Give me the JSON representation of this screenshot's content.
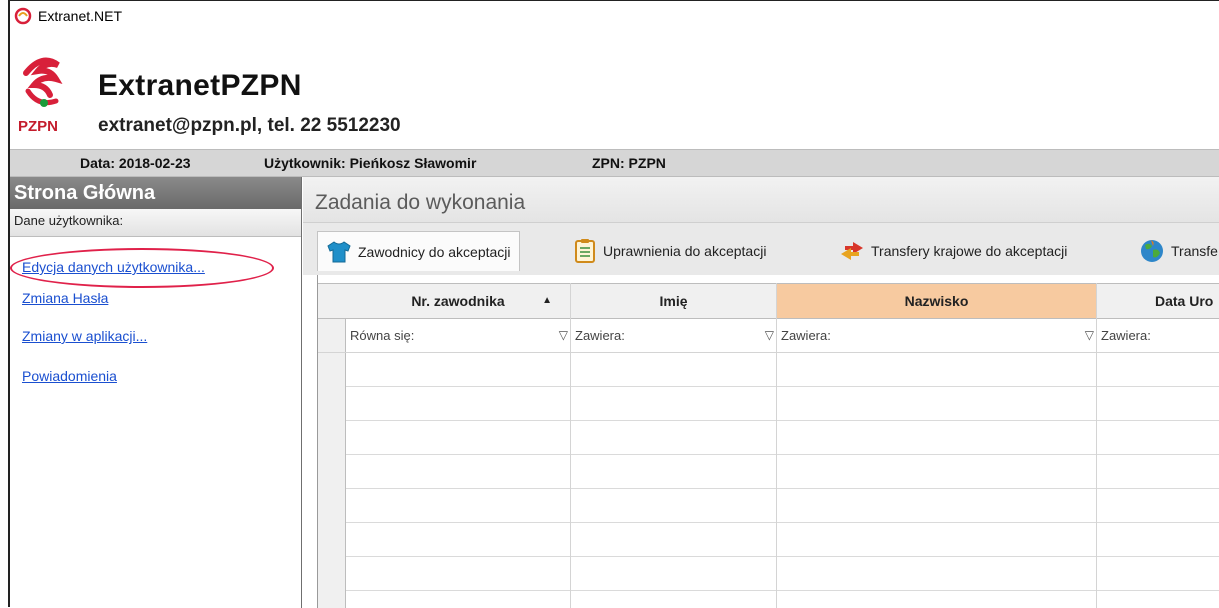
{
  "window": {
    "title": "Extranet.NET"
  },
  "header": {
    "app_title": "ExtranetPZPN",
    "contact": "extranet@pzpn.pl, tel. 22 5512230",
    "logo_text": "PZPN"
  },
  "infobar": {
    "date": "Data: 2018-02-23",
    "user": "Użytkownik: Pieńkosz Sławomir",
    "zpn": "ZPN: PZPN"
  },
  "sidebar": {
    "title": "Strona Główna",
    "section": "Dane użytkownika:",
    "links": [
      "Edycja danych użytkownika...",
      "Zmiana Hasła",
      "Zmiany w aplikacji...",
      "Powiadomienia"
    ]
  },
  "main": {
    "title": "Zadania do wykonania",
    "tabs": [
      "Zawodnicy do akceptacji",
      "Uprawnienia do akceptacji",
      "Transfery krajowe do akceptacji",
      "Transfe"
    ],
    "active_tab": 0
  },
  "grid": {
    "columns": [
      "Nr. zawodnika",
      "Imię",
      "Nazwisko",
      "Data Uro"
    ],
    "sorted_column_indicator": "▲",
    "selected_column": 2,
    "filters": [
      "Równa się:",
      "Zawiera:",
      "Zawiera:",
      "Zawiera:"
    ],
    "empty_rows": 7
  },
  "colors": {
    "link": "#1a4fd0",
    "highlight_ellipse": "#e0214a",
    "selected_header": "#f7caa0",
    "sidebar_header": "#777777"
  }
}
